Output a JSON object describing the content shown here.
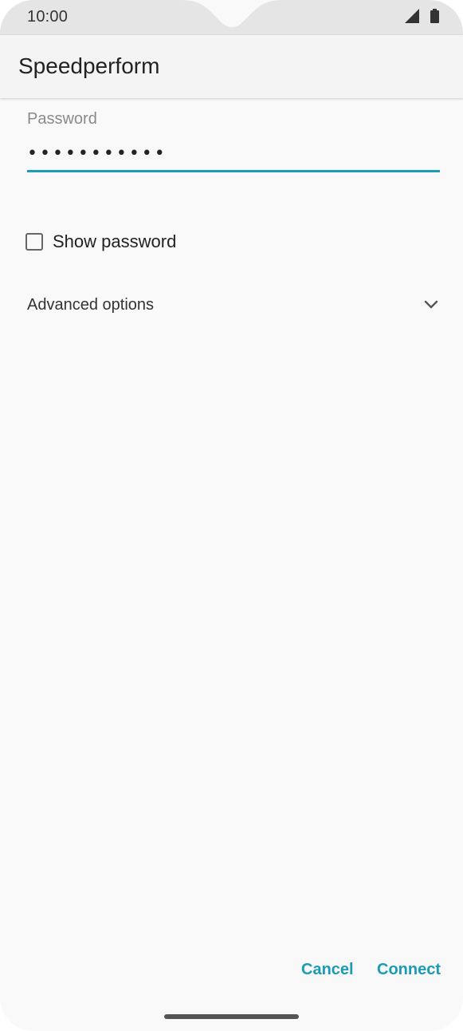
{
  "status_bar": {
    "time": "10:00",
    "icons": [
      "cellular-signal-icon",
      "battery-icon"
    ]
  },
  "app_bar": {
    "title": "Speedperform"
  },
  "password_field": {
    "label": "Password",
    "value": "•••••••••••"
  },
  "show_password": {
    "label": "Show password",
    "checked": false
  },
  "advanced": {
    "label": "Advanced options",
    "icon": "chevron-down-icon"
  },
  "actions": {
    "cancel_label": "Cancel",
    "connect_label": "Connect"
  },
  "colors": {
    "accent": "#1a9bb6",
    "status_bar": "#e5e5e5",
    "background": "#f9f9f9"
  }
}
